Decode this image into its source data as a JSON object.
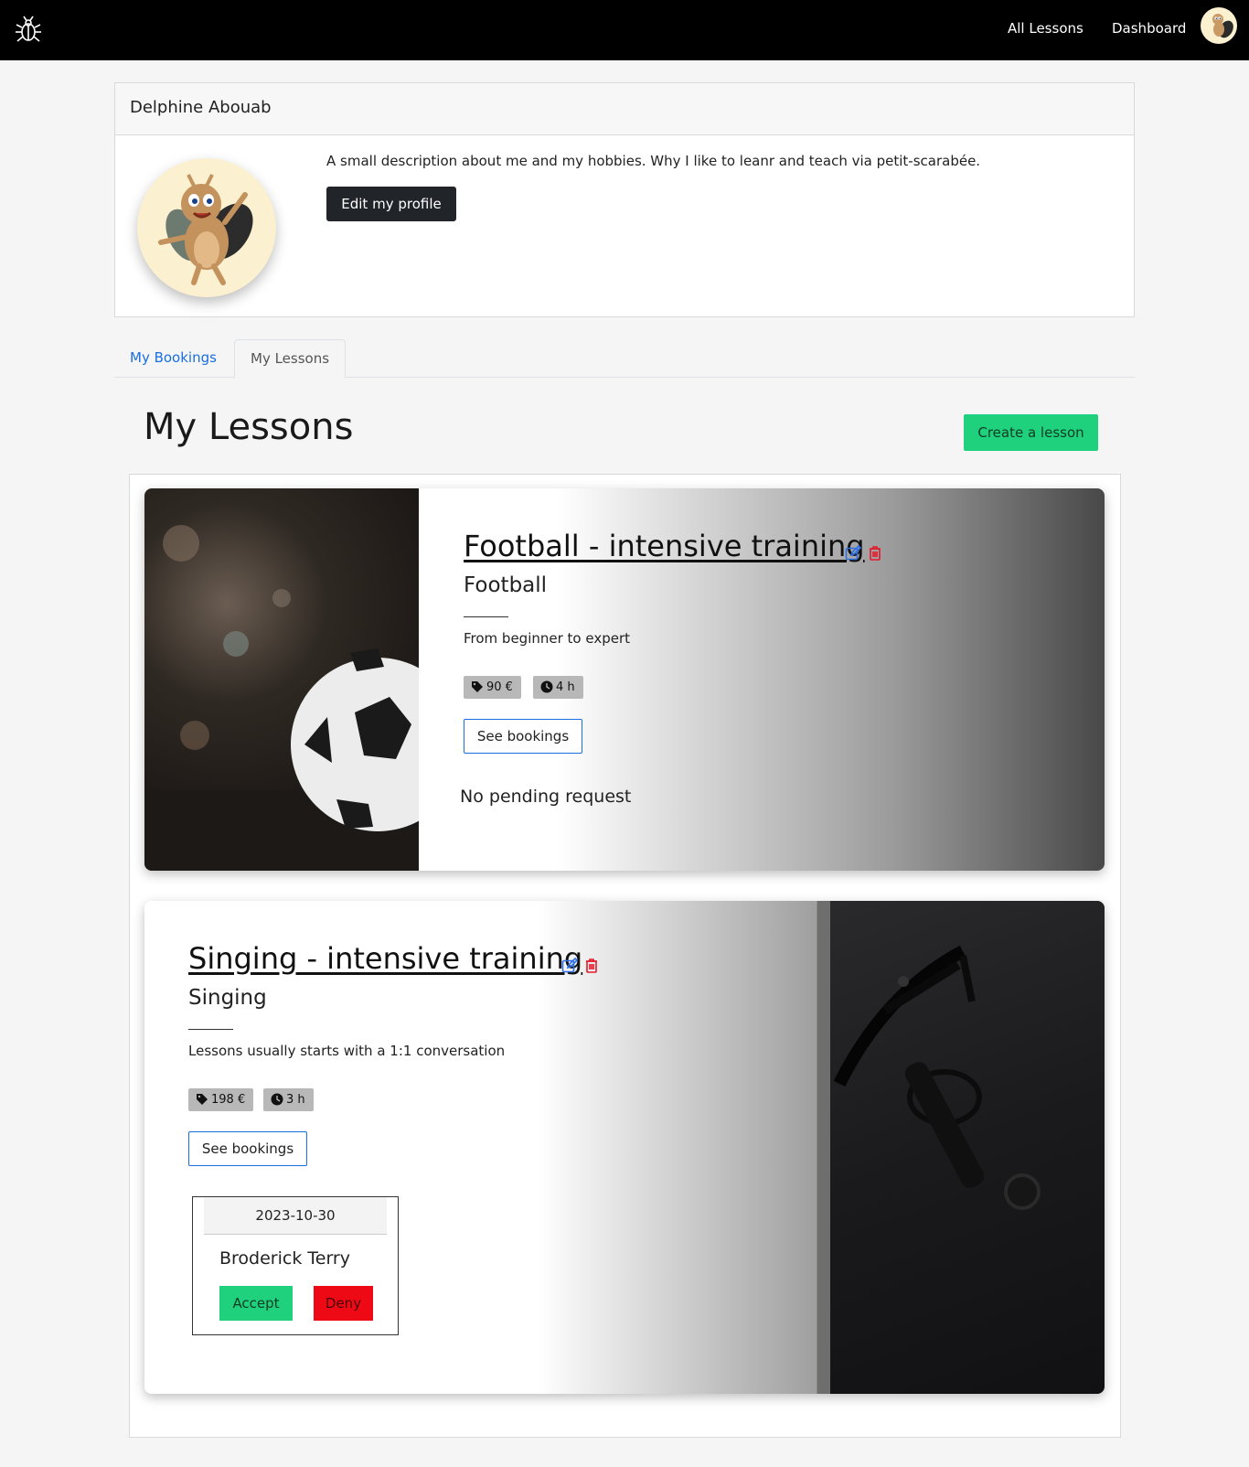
{
  "nav": {
    "all_lessons": "All Lessons",
    "dashboard": "Dashboard"
  },
  "profile": {
    "name": "Delphine Abouab",
    "description": "A small description about me and my hobbies. Why I like to leanr and teach via petit-scarabée.",
    "edit_label": "Edit my profile"
  },
  "tabs": [
    {
      "label": "My Bookings",
      "active": false
    },
    {
      "label": "My Lessons",
      "active": true
    }
  ],
  "lessons_header": {
    "title": "My Lessons",
    "create_label": "Create a lesson"
  },
  "lessons": [
    {
      "title": "Football - intensive training",
      "category": "Football",
      "description": "From beginner to expert",
      "price": "90 €",
      "duration": "4 h",
      "see_bookings": "See bookings",
      "pending_text": "No pending request"
    },
    {
      "title": "Singing - intensive training",
      "category": "Singing",
      "description": "Lessons usually starts with a 1:1 conversation",
      "price": "198 €",
      "duration": "3 h",
      "see_bookings": "See bookings",
      "requests": [
        {
          "date": "2023-10-30",
          "name": "Broderick Terry",
          "accept": "Accept",
          "deny": "Deny"
        }
      ]
    }
  ],
  "colors": {
    "navbar": "#000000",
    "accent_green": "#1fd17c",
    "deny_red": "#ee0a14",
    "link_blue": "#1a6fe0",
    "edit_icon": "#2d6fe6",
    "delete_icon": "#e5182a"
  }
}
